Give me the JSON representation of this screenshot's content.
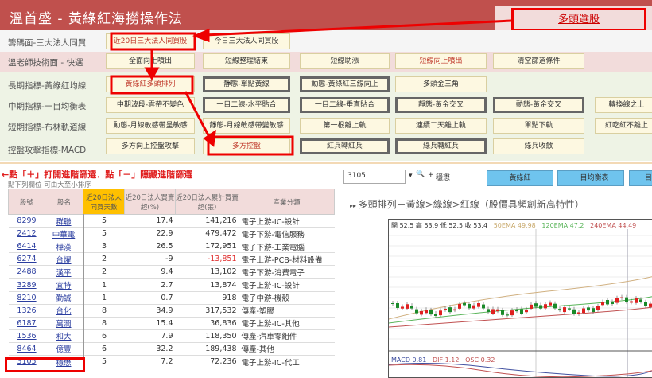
{
  "header": {
    "title": "溫首盛 - 黃綠紅海撈操作法",
    "top_button": "多頭選股"
  },
  "rows": [
    {
      "label": "籌碼面-三大法人同買",
      "buttons": [
        "近20日三大法人同買股",
        "今日三大法人同買股"
      ]
    },
    {
      "label": "溫老師技術面 - 快選",
      "buttons": [
        "全面向上噴出",
        "短線整理結束",
        "短線助漲",
        "短線向上噴出",
        "清空篩選條件"
      ]
    },
    {
      "label": "長期指標-黃綠紅均線",
      "buttons": [
        "黃綠紅多頭排列",
        "靜態-單點黃線",
        "動態-黃綠紅三線向上",
        "多頭金三角"
      ]
    },
    {
      "label": "中期指標-一目均衡表",
      "buttons": [
        "中期波段-雲帶不變色",
        "一目二線-水平貼合",
        "一目二線-垂直貼合",
        "靜態-黃金交叉",
        "動態-黃金交叉",
        "轉換線之上"
      ]
    },
    {
      "label": "短期指標-布林軌道線",
      "buttons": [
        "動態-月線敏感帶呈敏感",
        "靜態-月線敏感帶變敏感",
        "第一根離上軌",
        "連續二天離上軌",
        "單點下軌",
        "紅吃紅不離上"
      ]
    },
    {
      "label": "控盤攻擊指標-MACD",
      "buttons": [
        "多方向上控盤攻擊",
        "多方控盤",
        "紅兵轉紅兵",
        "綠兵轉紅兵",
        "綠兵收斂"
      ]
    }
  ],
  "hint": "←點「＋」打開進階篩選．點「－」隱藏進階篩選",
  "sort_hint": "點下列欄位 可由大至小排序",
  "table": {
    "headers": [
      "股號",
      "股名",
      "近20日法人同買天數",
      "近20日法人買賣超(%)",
      "近20日法人累計買賣超(張)",
      "產業分類"
    ],
    "rows": [
      [
        "8299",
        "群聯",
        "5",
        "17.4",
        "141,216",
        "電子上游-IC-設計"
      ],
      [
        "2412",
        "中華電",
        "5",
        "22.9",
        "479,472",
        "電子下游-電信服務"
      ],
      [
        "6414",
        "樺漢",
        "3",
        "26.5",
        "172,951",
        "電子下游-工業電腦"
      ],
      [
        "6274",
        "台燿",
        "2",
        "-9",
        "-13,851",
        "電子上游-PCB-材料設備"
      ],
      [
        "2488",
        "漢平",
        "2",
        "9.4",
        "13,102",
        "電子下游-消費電子"
      ],
      [
        "3289",
        "宜特",
        "1",
        "2.7",
        "13,874",
        "電子上游-IC-設計"
      ],
      [
        "8210",
        "勤誠",
        "1",
        "0.7",
        "918",
        "電子中游-機殼"
      ],
      [
        "1326",
        "台化",
        "8",
        "34.9",
        "317,532",
        "傳產-塑膠"
      ],
      [
        "6187",
        "萬潤",
        "8",
        "15.4",
        "36,836",
        "電子上游-IC-其他"
      ],
      [
        "1536",
        "和大",
        "6",
        "7.9",
        "118,350",
        "傳產-汽車零組件"
      ],
      [
        "8464",
        "億豐",
        "6",
        "32.2",
        "189,438",
        "傳產-其他"
      ],
      [
        "3105",
        "穩懋",
        "5",
        "7.2",
        "72,236",
        "電子上游-IC-代工"
      ]
    ]
  },
  "right": {
    "stock_input": "3105",
    "stock_name": "穩懋",
    "tabs": [
      "黃綠紅",
      "一目均衡表",
      "一目"
    ],
    "chart_title": "多頭排列－黃線>綠線>紅線（股價具頻創新高特性）",
    "ohlc": "開 52.5 高 53.9 低 52.5 收 53.4",
    "ema50": "50EMA 49.98",
    "ema120": "120EMA 47.2",
    "ema240": "240EMA 44.49",
    "macd": "MACD 0.81",
    "dif": "DIF 1.12",
    "osc": "OSC 0.32"
  }
}
